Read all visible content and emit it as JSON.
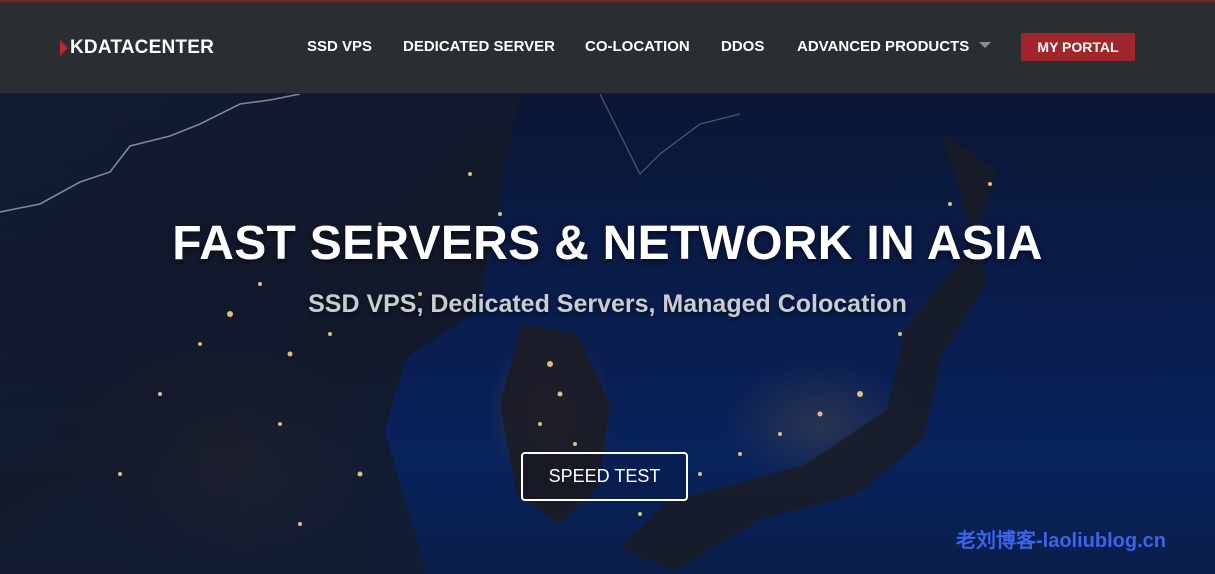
{
  "brand": {
    "logo_text": "KDATACENTER"
  },
  "nav": {
    "items": [
      {
        "label": "SSD VPS"
      },
      {
        "label": "DEDICATED SERVER"
      },
      {
        "label": "CO-LOCATION"
      },
      {
        "label": "DDOS"
      },
      {
        "label": "ADVANCED PRODUCTS"
      }
    ],
    "portal_label": "MY PORTAL"
  },
  "hero": {
    "title": "FAST SERVERS & NETWORK IN ASIA",
    "subtitle": "SSD VPS, Dedicated Servers, Managed Colocation",
    "button_label": "SPEED TEST"
  },
  "watermark": "老刘博客-laoliublog.cn",
  "colors": {
    "navbar_bg": "#2a2d31",
    "accent_red": "#a0262b",
    "watermark_blue": "#3d63e8"
  },
  "icons": {
    "dropdown": "caret-down-icon",
    "logo_mark": "k-logo-mark-icon"
  }
}
